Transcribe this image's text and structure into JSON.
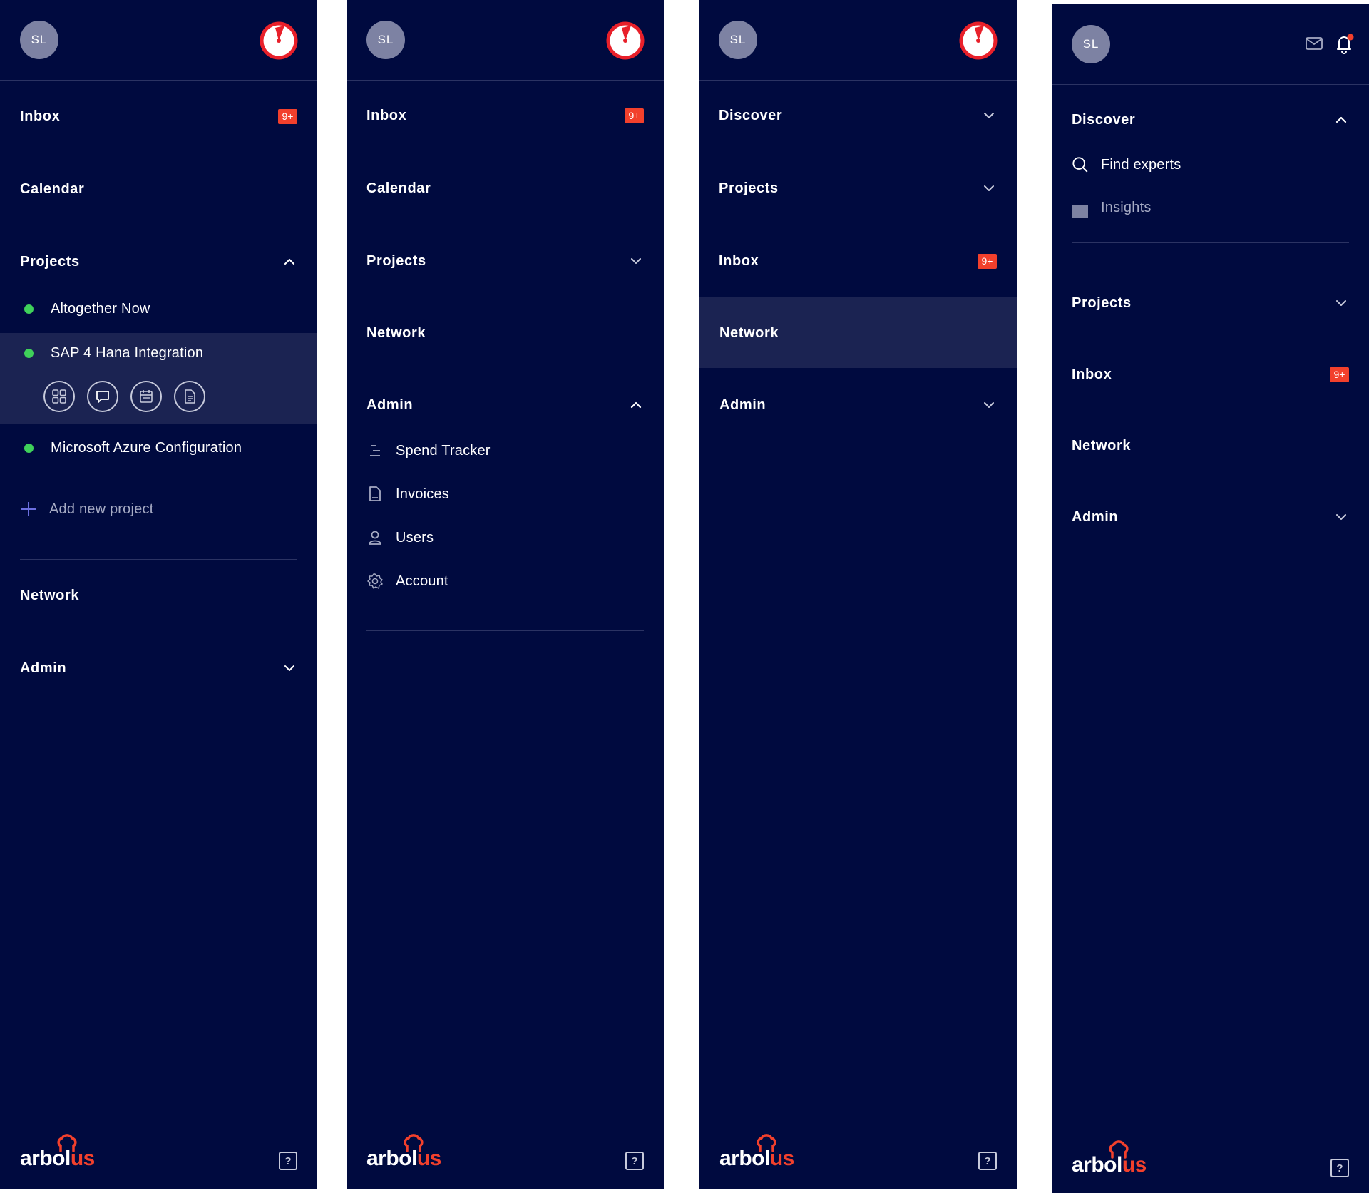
{
  "brand": {
    "logo_part1": "arbol",
    "logo_part2": "us",
    "accent": "#f2402c",
    "background": "#000a3f",
    "highlight": "#1b2352",
    "status_green": "#3fd15a"
  },
  "common": {
    "avatar_initials": "SL",
    "help_glyph": "?",
    "badge": "9+"
  },
  "panel1": {
    "inbox": "Inbox",
    "calendar": "Calendar",
    "projects": "Projects",
    "project_items": [
      "Altogether Now",
      "SAP 4 Hana Integration",
      "Microsoft Azure Configuration"
    ],
    "add_project": "Add new project",
    "network": "Network",
    "admin": "Admin",
    "quick_actions": [
      "grid-icon",
      "chat-icon",
      "calendar-icon",
      "document-icon"
    ]
  },
  "panel2": {
    "inbox": "Inbox",
    "calendar": "Calendar",
    "projects": "Projects",
    "network": "Network",
    "admin": "Admin",
    "admin_items": [
      "Spend Tracker",
      "Invoices",
      "Users",
      "Account"
    ]
  },
  "panel3": {
    "discover": "Discover",
    "projects": "Projects",
    "inbox": "Inbox",
    "network": "Network",
    "admin": "Admin"
  },
  "panel4": {
    "discover": "Discover",
    "discover_items": [
      "Find experts",
      "Insights"
    ],
    "projects": "Projects",
    "inbox": "Inbox",
    "network": "Network",
    "admin": "Admin"
  }
}
